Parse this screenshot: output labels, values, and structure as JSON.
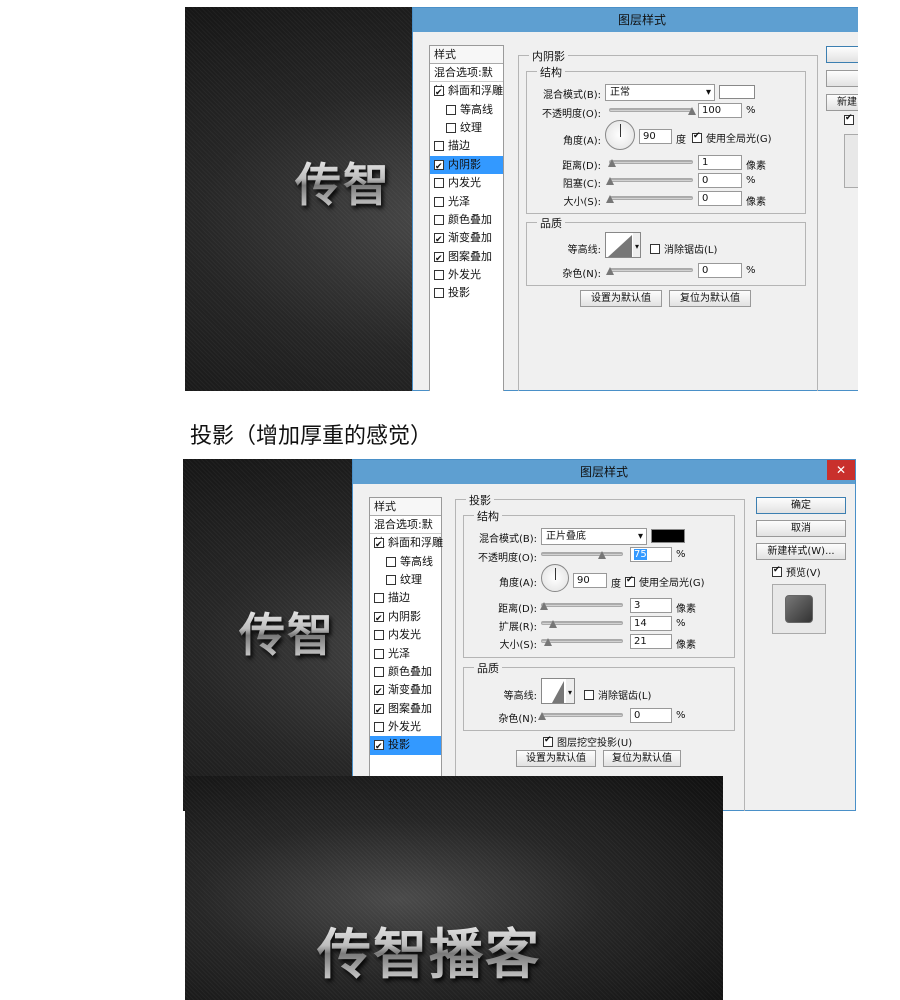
{
  "dialog_title": "图层样式",
  "styles_header": "样式",
  "blend_options": "混合选项:默认",
  "style_items": {
    "bevel": "斜面和浮雕",
    "contour": "等高线",
    "texture": "纹理",
    "stroke": "描边",
    "inner_shadow": "内阴影",
    "inner_glow": "内发光",
    "satin": "光泽",
    "color_overlay": "颜色叠加",
    "gradient_overlay": "渐变叠加",
    "pattern_overlay": "图案叠加",
    "outer_glow": "外发光",
    "drop_shadow": "投影"
  },
  "labels": {
    "structure": "结构",
    "quality": "品质",
    "blend_mode": "混合模式(B):",
    "opacity": "不透明度(O):",
    "angle": "角度(A):",
    "global_light": "使用全局光(G)",
    "distance": "距离(D):",
    "choke": "阻塞(C):",
    "spread": "扩展(R):",
    "size": "大小(S):",
    "contour": "等高线:",
    "anti_alias": "消除锯齿(L)",
    "noise": "杂色(N):",
    "knockout": "图层挖空投影(U)",
    "make_default": "设置为默认值",
    "reset_default": "复位为默认值",
    "unit_degree": "度",
    "unit_px": "像素",
    "unit_pct": "%"
  },
  "top_dialog": {
    "section_title": "内阴影",
    "blend_mode": "正常",
    "opacity": "100",
    "angle": "90",
    "distance": "1",
    "choke": "0",
    "size": "0",
    "noise": "0",
    "new_style_partial": "新建"
  },
  "bottom_dialog": {
    "section_title": "投影",
    "blend_mode": "正片叠底",
    "opacity": "75",
    "angle": "90",
    "distance": "3",
    "spread": "14",
    "size": "21",
    "noise": "0",
    "ok": "确定",
    "cancel": "取消",
    "new_style": "新建样式(W)...",
    "preview": "预览(V)",
    "close": "✕"
  },
  "caption": "投影（增加厚重的感觉）",
  "canvas_text_short": "传智",
  "canvas_text_full": "传智播客",
  "colors": {
    "top_shadow_swatch": "#ffffff",
    "bottom_shadow_swatch": "#000000",
    "titlebar": "#5e9fd1",
    "selection": "#3399ff"
  }
}
